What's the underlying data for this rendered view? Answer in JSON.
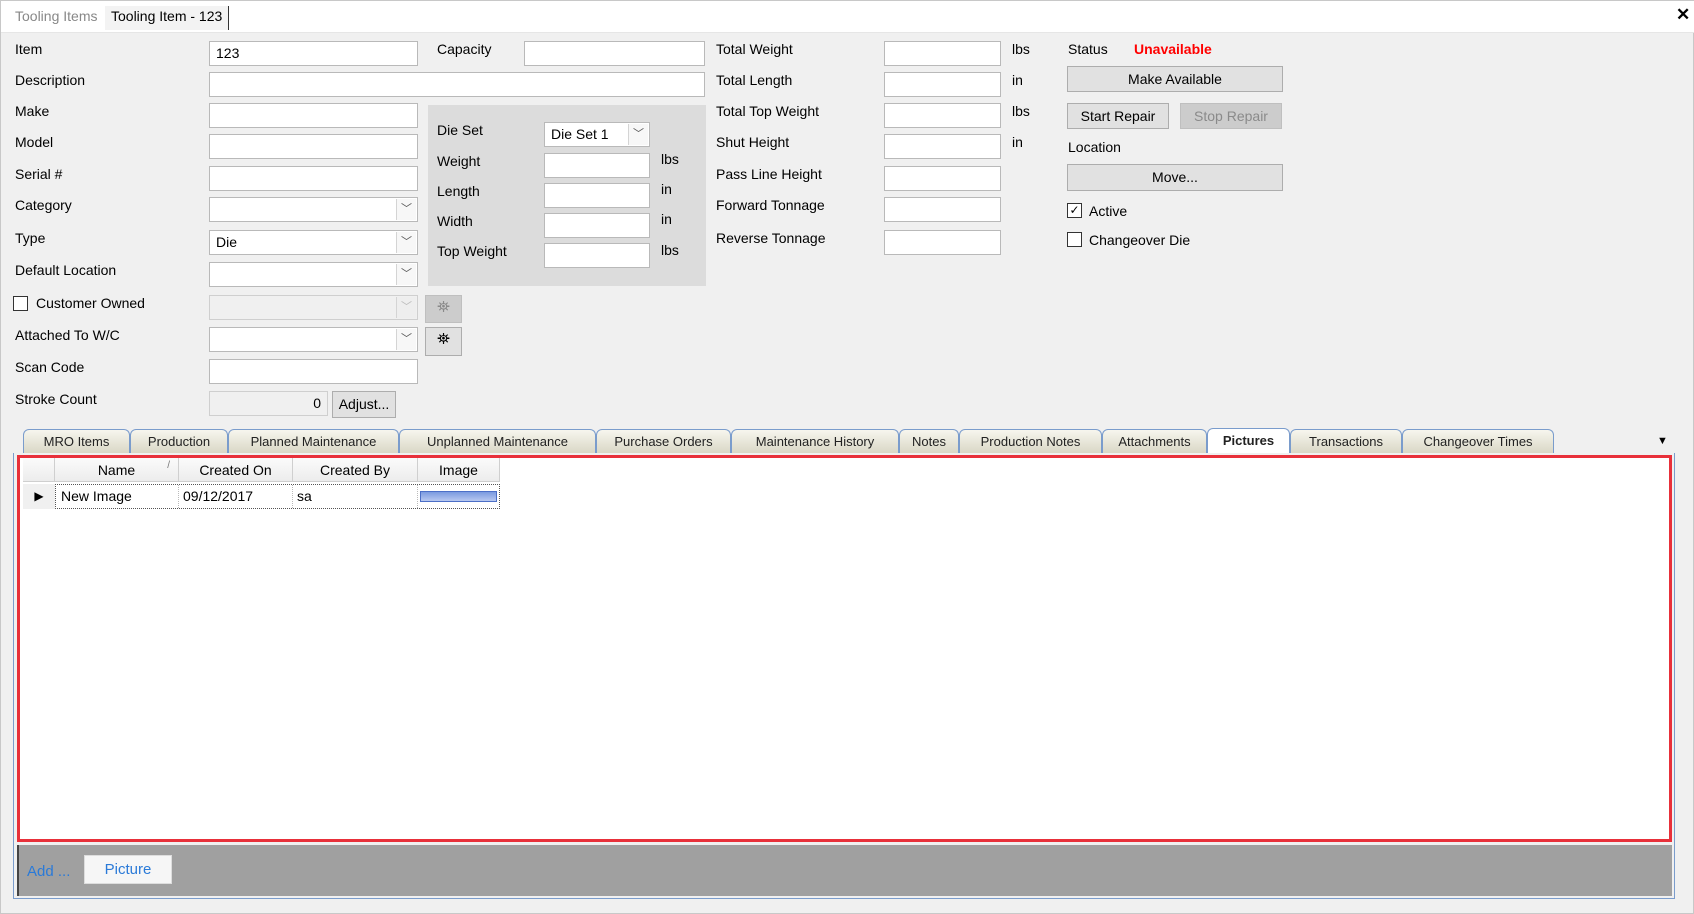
{
  "doc_tabs": [
    "Tooling Items",
    "Tooling Item - 123"
  ],
  "close_icon": "close-icon",
  "left": {
    "item": {
      "label": "Item",
      "value": "123"
    },
    "description": {
      "label": "Description",
      "value": ""
    },
    "make": {
      "label": "Make",
      "value": ""
    },
    "model": {
      "label": "Model",
      "value": ""
    },
    "serial": {
      "label": "Serial #",
      "value": ""
    },
    "category": {
      "label": "Category",
      "value": ""
    },
    "type": {
      "label": "Type",
      "value": "Die"
    },
    "default_location": {
      "label": "Default Location",
      "value": ""
    },
    "customer_owned": {
      "label": "Customer Owned",
      "checked": false
    },
    "attached_wc": {
      "label": "Attached To W/C",
      "value": ""
    },
    "scan_code": {
      "label": "Scan Code",
      "value": ""
    },
    "stroke_count": {
      "label": "Stroke Count",
      "value": "0",
      "adjust": "Adjust..."
    },
    "capacity": {
      "label": "Capacity",
      "value": ""
    }
  },
  "die_set": {
    "die_set": {
      "label": "Die Set",
      "value": "Die Set 1"
    },
    "weight": {
      "label": "Weight",
      "unit": "lbs"
    },
    "length": {
      "label": "Length",
      "unit": "in"
    },
    "width": {
      "label": "Width",
      "unit": "in"
    },
    "top_weight": {
      "label": "Top Weight",
      "unit": "lbs"
    }
  },
  "totals": [
    {
      "label": "Total Weight",
      "unit": "lbs"
    },
    {
      "label": "Total Length",
      "unit": "in"
    },
    {
      "label": "Total Top Weight",
      "unit": "lbs"
    },
    {
      "label": "Shut Height",
      "unit": "in"
    },
    {
      "label": "Pass Line Height",
      "unit": ""
    },
    {
      "label": "Forward Tonnage",
      "unit": ""
    },
    {
      "label": "Reverse Tonnage",
      "unit": ""
    }
  ],
  "status": {
    "label": "Status",
    "value": "Unavailable",
    "color": "#ff0000",
    "make_available": "Make Available",
    "start_repair": "Start Repair",
    "stop_repair": "Stop Repair",
    "location_label": "Location",
    "move": "Move...",
    "active": {
      "label": "Active",
      "checked": true
    },
    "changeover": {
      "label": "Changeover Die",
      "checked": false
    }
  },
  "tabs": [
    "MRO Items",
    "Production",
    "Planned Maintenance",
    "Unplanned Maintenance",
    "Purchase Orders",
    "Maintenance History",
    "Notes",
    "Production Notes",
    "Attachments",
    "Pictures",
    "Transactions",
    "Changeover Times"
  ],
  "active_tab": "Pictures",
  "grid": {
    "columns": [
      "Name",
      "Created On",
      "Created By",
      "Image"
    ],
    "rows": [
      {
        "name": "New Image",
        "created_on": "09/12/2017",
        "created_by": "sa"
      }
    ]
  },
  "footer": {
    "add": "Add ...",
    "picture": "Picture"
  },
  "highlight_color": "#e8303a"
}
